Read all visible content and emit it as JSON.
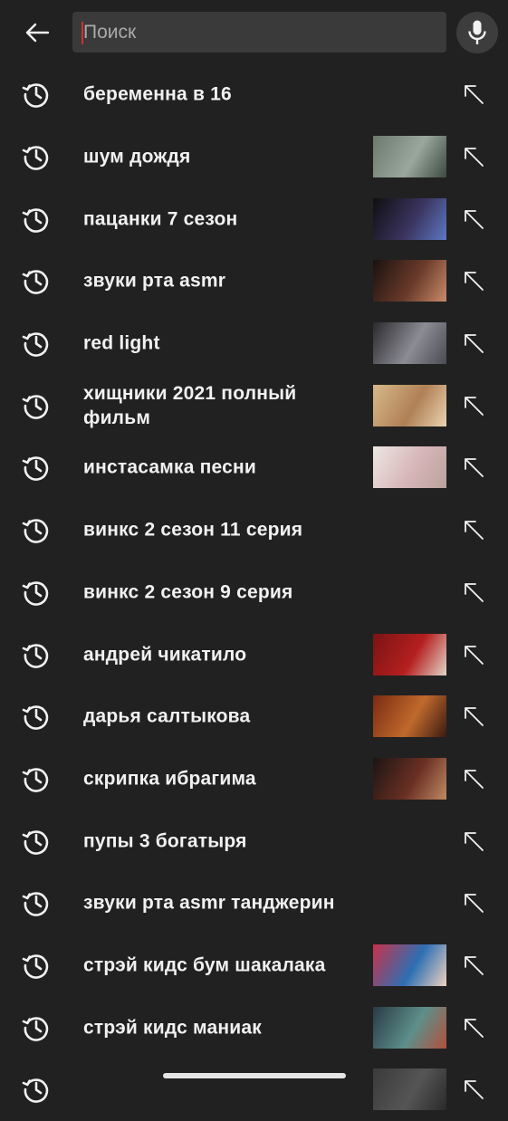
{
  "search": {
    "placeholder": "Поиск",
    "value": ""
  },
  "icons": {
    "back": "back-arrow-icon",
    "mic": "microphone-icon",
    "history": "history-icon",
    "fill": "fill-query-arrow-icon"
  },
  "colors": {
    "background": "#212121",
    "search_bg": "#3a3a3a",
    "caret": "#d32f2f"
  },
  "suggestions": [
    {
      "label": "беременна в 16",
      "thumb": false
    },
    {
      "label": "шум дождя",
      "thumb": true,
      "thumb_palette": [
        "#6b7a6e",
        "#9aa79c",
        "#3c4a40"
      ]
    },
    {
      "label": "пацанки 7 сезон",
      "thumb": true,
      "thumb_palette": [
        "#0f0f10",
        "#3b3560",
        "#5c78c4"
      ]
    },
    {
      "label": "звуки рта asmr",
      "thumb": true,
      "thumb_palette": [
        "#1a1210",
        "#6a3a2a",
        "#c98b6a"
      ]
    },
    {
      "label": "red light",
      "thumb": true,
      "thumb_palette": [
        "#2a2a2e",
        "#8c8c94",
        "#4a4a52"
      ]
    },
    {
      "label": "хищники 2021 полный фильм",
      "thumb": true,
      "thumb_palette": [
        "#d7b98a",
        "#b08056",
        "#e9d4b0"
      ]
    },
    {
      "label": "инстасамка песни",
      "thumb": true,
      "thumb_palette": [
        "#ece7e2",
        "#d7b5b8",
        "#b9a39c"
      ]
    },
    {
      "label": "винкс 2 сезон 11 серия",
      "thumb": false
    },
    {
      "label": "винкс 2 сезон 9 серия",
      "thumb": false
    },
    {
      "label": "андрей чикатило",
      "thumb": true,
      "thumb_palette": [
        "#7a1414",
        "#b51f1f",
        "#e2d5c8"
      ]
    },
    {
      "label": "дарья салтыкова",
      "thumb": true,
      "thumb_palette": [
        "#7a2b12",
        "#c0692c",
        "#3b1b12"
      ]
    },
    {
      "label": "скрипка ибрагима",
      "thumb": true,
      "thumb_palette": [
        "#1b1514",
        "#6a2f23",
        "#c08a64"
      ]
    },
    {
      "label": "пупы 3 богатыря",
      "thumb": false
    },
    {
      "label": "звуки рта asmr танджерин",
      "thumb": false
    },
    {
      "label": "стрэй кидс бум шакалака",
      "thumb": true,
      "thumb_palette": [
        "#c9324a",
        "#2d6fb3",
        "#f0d2c0"
      ]
    },
    {
      "label": "стрэй кидс маниак",
      "thumb": true,
      "thumb_palette": [
        "#2a3a45",
        "#5d8f8a",
        "#b2503c"
      ]
    },
    {
      "label": "",
      "thumb": true,
      "thumb_palette": [
        "#3a3a3a",
        "#555555",
        "#2a2a2a"
      ]
    }
  ]
}
